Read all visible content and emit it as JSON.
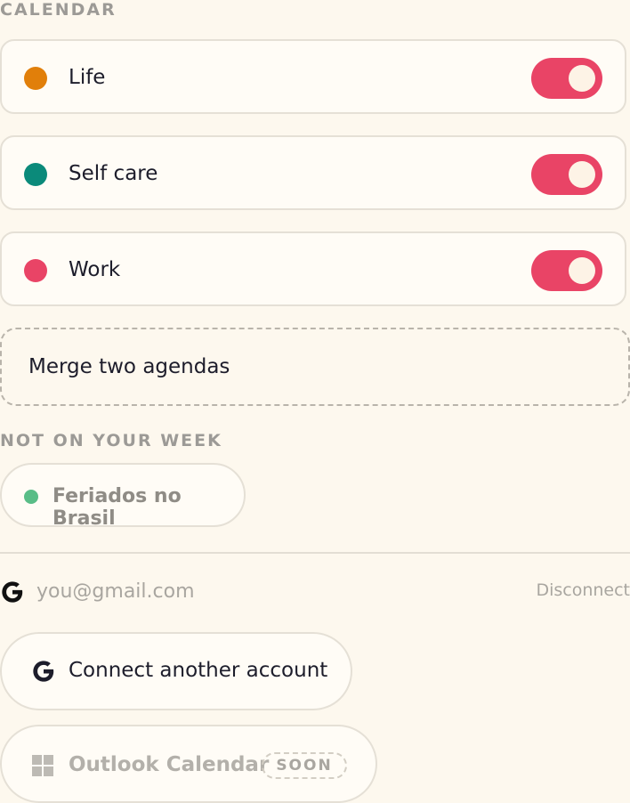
{
  "calendar_section": {
    "title": "CALENDAR",
    "calendars": [
      {
        "label": "Life",
        "color": "#e17f0a",
        "enabled": true
      },
      {
        "label": "Self care",
        "color": "#0b8a7a",
        "enabled": true
      },
      {
        "label": "Work",
        "color": "#e94466",
        "enabled": true
      }
    ],
    "toggle_color": "#e94466",
    "merge_label": "Merge two agendas"
  },
  "not_on_week": {
    "title": "NOT ON YOUR WEEK",
    "items": [
      {
        "label": "Feriados no Brasil",
        "color": "#59bd87"
      }
    ]
  },
  "account": {
    "provider_icon": "google-icon",
    "email": "you@gmail.com",
    "disconnect_label": "Disconnect"
  },
  "actions": {
    "connect_label": "Connect another account",
    "outlook_label": "Outlook Calendar",
    "outlook_icon": "windows-icon",
    "soon_badge": "SOON"
  }
}
